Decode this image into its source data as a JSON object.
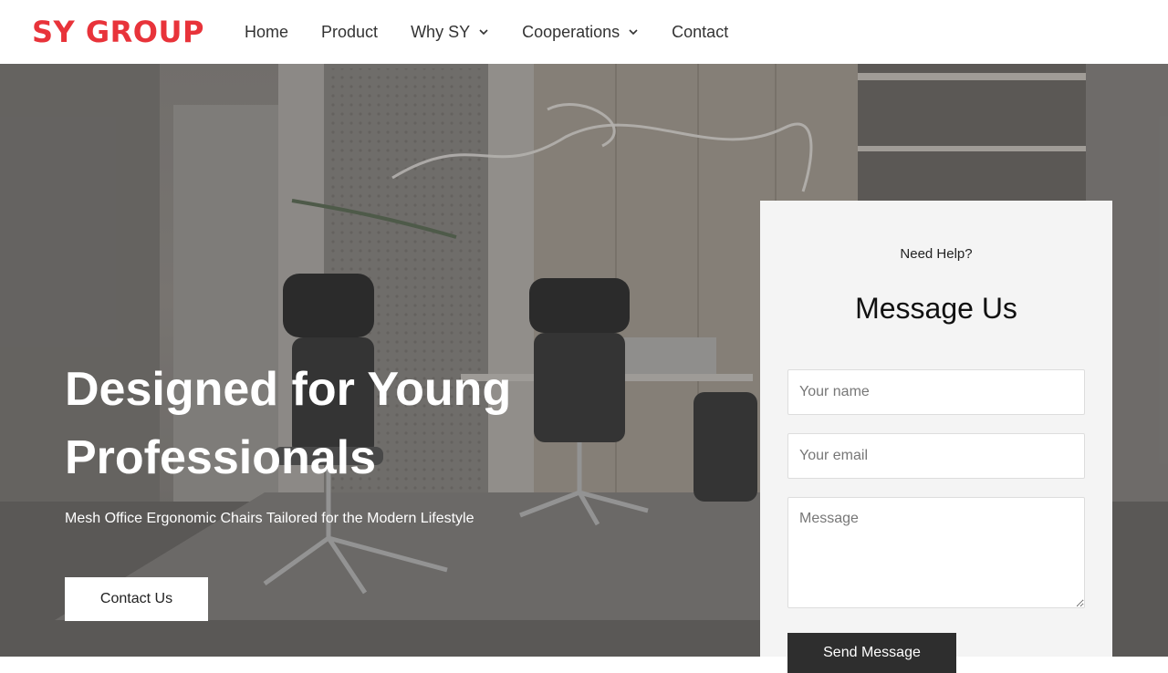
{
  "brand": {
    "logo_text": "SY GROUP",
    "color": "#e8333a"
  },
  "nav": {
    "items": [
      {
        "label": "Home",
        "has_dropdown": false
      },
      {
        "label": "Product",
        "has_dropdown": false
      },
      {
        "label": "Why SY",
        "has_dropdown": true
      },
      {
        "label": "Cooperations",
        "has_dropdown": true
      },
      {
        "label": "Contact",
        "has_dropdown": false
      }
    ]
  },
  "hero": {
    "title": "Designed for Young Professionals",
    "subtitle": "Mesh Office Ergonomic Chairs Tailored for the Modern Lifestyle",
    "cta_label": "Contact Us"
  },
  "contact_form": {
    "pre_title": "Need Help?",
    "title": "Message Us",
    "name_placeholder": "Your name",
    "email_placeholder": "Your email",
    "message_placeholder": "Message",
    "submit_label": "Send Message"
  }
}
